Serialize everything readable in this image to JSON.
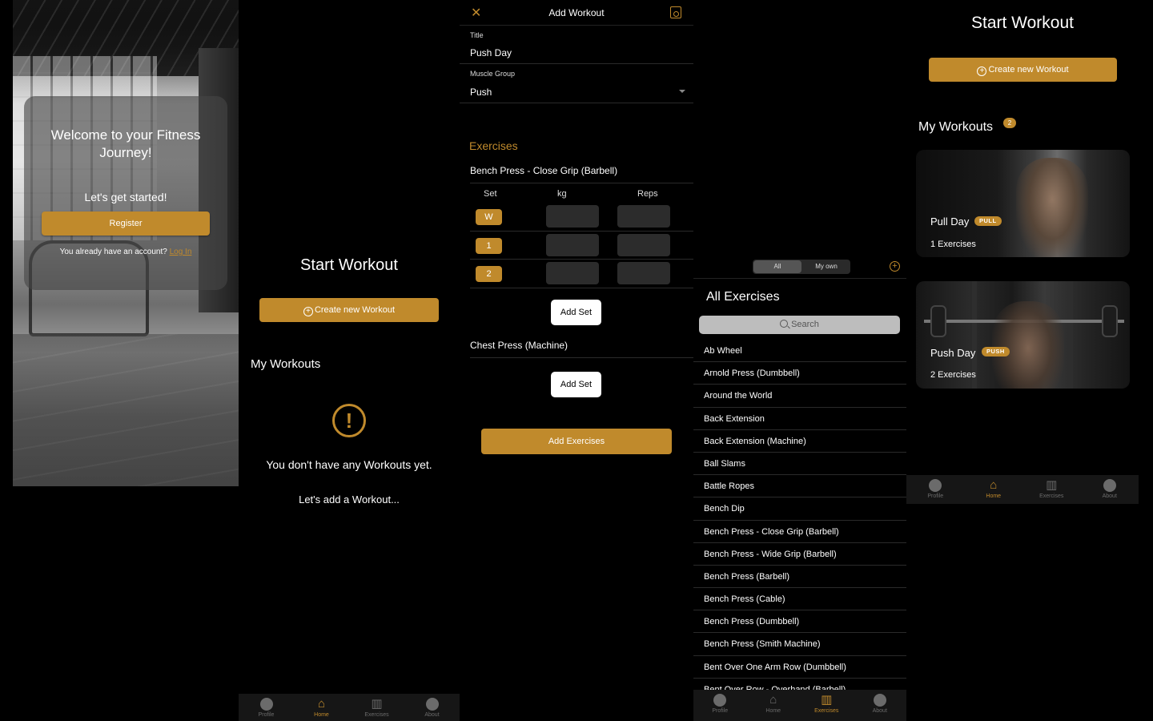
{
  "welcome": {
    "title": "Welcome to your Fitness Journey!",
    "subtitle": "Let's get started!",
    "register_label": "Register",
    "account_text": "You already have an account?",
    "login_label": "Log In"
  },
  "empty_home": {
    "title": "Start Workout",
    "create_label": "Create new Workout",
    "my_workouts": "My Workouts",
    "empty_text": "You don't have any Workouts yet.",
    "cta_text": "Let's add a Workout..."
  },
  "add_workout": {
    "header_title": "Add Workout",
    "title_label": "Title",
    "title_value": "Push Day",
    "muscle_label": "Muscle Group",
    "muscle_value": "Push",
    "exercises_heading": "Exercises",
    "exercise1": "Bench Press - Close Grip (Barbell)",
    "col_set": "Set",
    "col_kg": "kg",
    "col_reps": "Reps",
    "sets": [
      "W",
      "1",
      "2"
    ],
    "add_set_label": "Add Set",
    "exercise2": "Chest Press (Machine)",
    "add_exercises_label": "Add Exercises"
  },
  "exercises": {
    "seg_all": "All",
    "seg_own": "My own",
    "title": "All Exercises",
    "search_placeholder": "Search",
    "items": [
      "Ab Wheel",
      "Arnold Press (Dumbbell)",
      "Around the World",
      "Back Extension",
      "Back Extension (Machine)",
      "Ball Slams",
      "Battle Ropes",
      "Bench Dip",
      "Bench Press - Close Grip (Barbell)",
      "Bench Press - Wide Grip (Barbell)",
      "Bench Press (Barbell)",
      "Bench Press (Cable)",
      "Bench Press (Dumbbell)",
      "Bench Press (Smith Machine)",
      "Bent Over One Arm Row (Dumbbell)",
      "Bent Over Row - Overhand (Barbell)"
    ]
  },
  "home": {
    "title": "Start Workout",
    "create_label": "Create new Workout",
    "my_workouts": "My Workouts",
    "count": "2",
    "workouts": [
      {
        "name": "Pull Day",
        "tag": "PULL",
        "count": "1 Exercises"
      },
      {
        "name": "Push Day",
        "tag": "PUSH",
        "count": "2 Exercises"
      }
    ]
  },
  "tabs": {
    "profile": "Profile",
    "home": "Home",
    "exercises": "Exercises",
    "about": "About"
  },
  "colors": {
    "accent": "#c08a2c",
    "background": "#000000"
  }
}
